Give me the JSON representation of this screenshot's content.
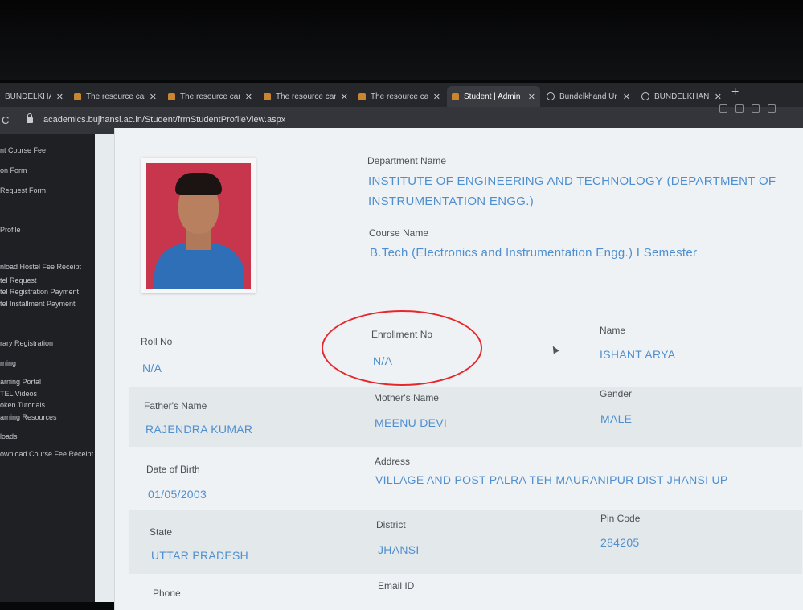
{
  "browser": {
    "tabs": [
      {
        "label": "BUNDELKHAND U",
        "icon": "globe-icon",
        "active": false
      },
      {
        "label": "The resource cann",
        "icon": "bu-favicon-icon",
        "active": false
      },
      {
        "label": "The resource cann",
        "icon": "bu-favicon-icon",
        "active": false
      },
      {
        "label": "The resource cann",
        "icon": "bu-favicon-icon",
        "active": false
      },
      {
        "label": "The resource cann",
        "icon": "bu-favicon-icon",
        "active": false
      },
      {
        "label": "Student | Admin",
        "icon": "bu-favicon-icon",
        "active": true
      },
      {
        "label": "Bundelkhand Univ",
        "icon": "globe-icon",
        "active": false
      },
      {
        "label": "BUNDELKHAND U",
        "icon": "globe-icon",
        "active": false
      }
    ],
    "close_glyph": "✕",
    "new_tab_glyph": "+",
    "reload_glyph": "C",
    "url": "academics.bujhansi.ac.in/Student/frmStudentProfileView.aspx"
  },
  "sidebar": {
    "items": [
      "nt Course Fee",
      "on Form",
      "Request Form",
      "Profile",
      "nload Hostel Fee Receipt",
      "tel Request",
      "tel Registration Payment",
      "tel Installment Payment",
      "rary Registration",
      "rning",
      "arning Portal",
      "TEL Videos",
      "oken Tutorials",
      "arning Resources",
      "loads",
      "ownload Course Fee Receipt"
    ]
  },
  "profile": {
    "department_label": "Department Name",
    "department_line1": "INSTITUTE OF ENGINEERING AND TECHNOLOGY (DEPARTMENT OF",
    "department_line2": "INSTRUMENTATION ENGG.)",
    "course_label": "Course Name",
    "course_value": "B.Tech (Electronics and Instrumentation Engg.) I Semester",
    "roll_label": "Roll No",
    "roll_value": "N/A",
    "enrollment_label": "Enrollment No",
    "enrollment_value": "N/A",
    "name_label": "Name",
    "name_value": "ISHANT ARYA",
    "father_label": "Father's Name",
    "father_value": "RAJENDRA KUMAR",
    "mother_label": "Mother's Name",
    "mother_value": "MEENU DEVI",
    "gender_label": "Gender",
    "gender_value": "MALE",
    "dob_label": "Date of Birth",
    "dob_value": "01/05/2003",
    "address_label": "Address",
    "address_value": "VILLAGE AND POST PALRA TEH MAURANIPUR DIST JHANSI UP",
    "state_label": "State",
    "state_value": "UTTAR PRADESH",
    "district_label": "District",
    "district_value": "JHANSI",
    "pin_label": "Pin Code",
    "pin_value": "284205",
    "phone_label": "Phone",
    "email_label": "Email ID"
  },
  "colors": {
    "value_text": "#4f8fd0",
    "annotation_ring": "#e8272b"
  }
}
